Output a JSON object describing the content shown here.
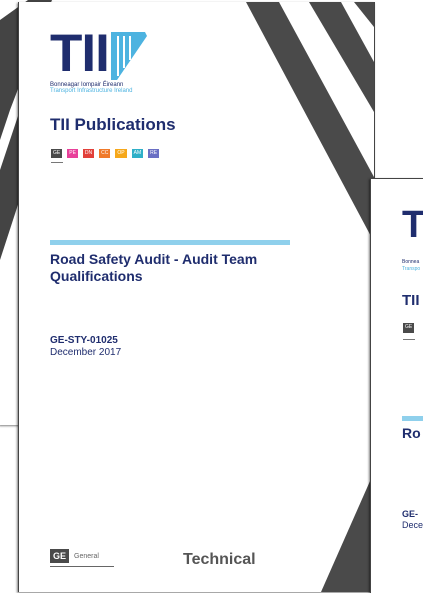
{
  "documents": {
    "main": {
      "logo": {
        "letters": "TII",
        "org_irish": "Bonneagar Iompair Éireann",
        "org_english": "Transport Infrastructure Ireland"
      },
      "publications_heading": "TII Publications",
      "tags": [
        {
          "label": "GE",
          "color": "#4a4a4a"
        },
        {
          "label": "PE",
          "color": "#e8409a"
        },
        {
          "label": "DN",
          "color": "#e2403a"
        },
        {
          "label": "CC",
          "color": "#f07a2a"
        },
        {
          "label": "OP",
          "color": "#f6a81b"
        },
        {
          "label": "AM",
          "color": "#2fb0c8"
        },
        {
          "label": "RE",
          "color": "#6a6fc4"
        }
      ],
      "title_line1": "Road Safety Audit - Audit Team",
      "title_line2": "Qualifications",
      "code": "GE-STY-01025",
      "date": "December 2017",
      "footer": {
        "badge": "GE",
        "badge_label": "General",
        "category": "Technical"
      }
    },
    "right": {
      "logo_letters": "TI",
      "org_irish_partial": "Bonnea",
      "org_english_partial": "Transpo",
      "publications_partial": "TII",
      "tag": "GE",
      "title_partial": "Ro",
      "code_partial": "GE-",
      "date_partial": "Dece"
    }
  },
  "colors": {
    "navy": "#1f2d6e",
    "light_blue": "#4db3e0",
    "rule_blue": "#8fd0ec",
    "stripe_gray": "#444444"
  }
}
